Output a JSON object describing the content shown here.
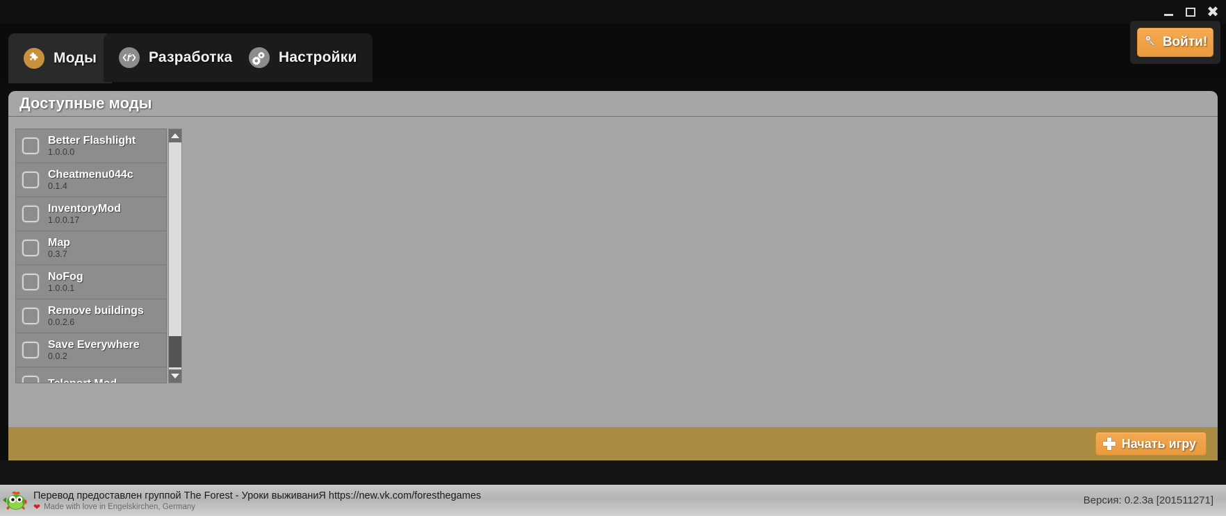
{
  "window": {
    "controls": [
      {
        "name": "minimize",
        "label": "—"
      },
      {
        "name": "maximize",
        "label": "□"
      },
      {
        "name": "close",
        "label": "×"
      }
    ]
  },
  "tabs": [
    {
      "label": "Моды",
      "icon": "puzzle-icon",
      "active": true
    },
    {
      "label": "Разработка",
      "icon": "code-wrench-icon",
      "active": false
    },
    {
      "label": "Настройки",
      "icon": "gears-icon",
      "active": false
    }
  ],
  "login": {
    "label": "Войти!",
    "icon": "key-icon"
  },
  "panel": {
    "title": "Доступные моды"
  },
  "mods": [
    {
      "name": "Better Flashlight",
      "version": "1.0.0.0",
      "checked": false
    },
    {
      "name": "Cheatmenu044c",
      "version": "0.1.4",
      "checked": false
    },
    {
      "name": "InventoryMod",
      "version": "1.0.0.17",
      "checked": false
    },
    {
      "name": "Map",
      "version": "0.3.7",
      "checked": false
    },
    {
      "name": "NoFog",
      "version": "1.0.0.1",
      "checked": false
    },
    {
      "name": "Remove buildings",
      "version": "0.0.2.6",
      "checked": false
    },
    {
      "name": "Save Everywhere",
      "version": "0.0.2",
      "checked": false
    },
    {
      "name": "Teleport Mod",
      "version": "",
      "checked": false
    }
  ],
  "scrollbar": {
    "up_icon": "chevron-up-icon",
    "down_icon": "chevron-down-icon"
  },
  "action_bar": {
    "start_label": "Начать игру",
    "start_icon": "plus-icon"
  },
  "statusbar": {
    "mascot_icon": "fish-mascot-icon",
    "line1": "Перевод предоставлен группой The Forest - Уроки выживаниЯ https://new.vk.com/foresthegames",
    "heart_icon": "heart-icon",
    "line2": "Made with love in Engelskirchen, Germany",
    "version": "Версия:  0.2.3a [201511271]"
  },
  "colors": {
    "accent_orange": "#eb9a3b",
    "action_bar": "#a98b42",
    "panel_grey": "#a6a6a6",
    "list_grey": "#8d8d8d"
  }
}
